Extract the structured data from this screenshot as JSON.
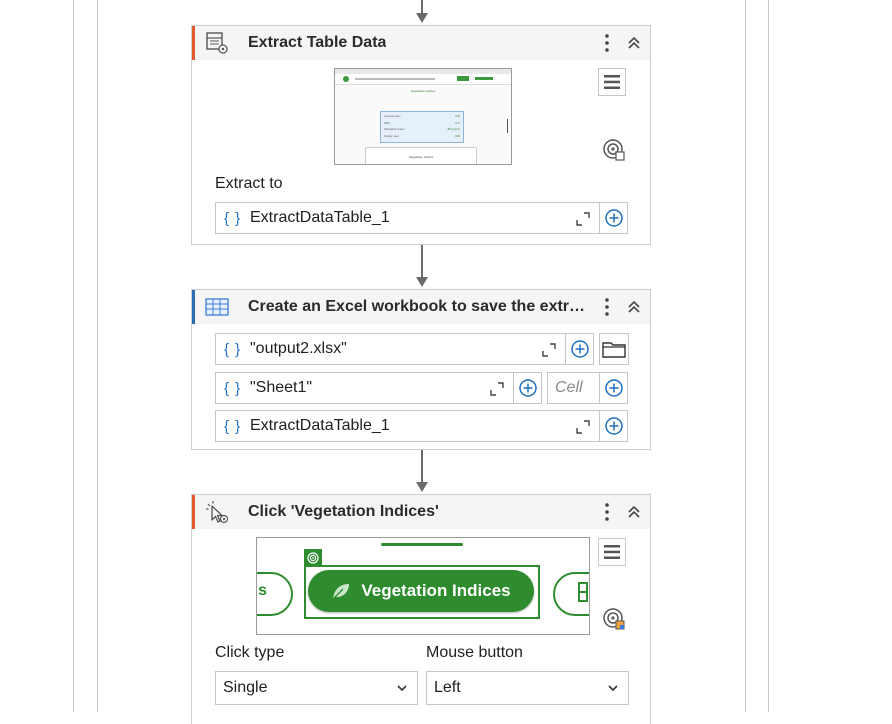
{
  "activities": [
    {
      "title": "Extract Table Data",
      "extract_label": "Extract to",
      "extract_value": "ExtractDataTable_1",
      "preview": {
        "heading": "Vegetation Indices",
        "rows": [
          "Leaf area index",
          "NDVI",
          "Chlorophyll content",
          "Canopy cover"
        ],
        "values": [
          "0.62",
          "0.74",
          "38.5 µg/cm²",
          "81%"
        ],
        "footer": "Vegetation Indices"
      }
    },
    {
      "title": "Create an Excel workbook to save the extra...",
      "file_value": "\"output2.xlsx\"",
      "sheet_value": "\"Sheet1\"",
      "cell_placeholder": "Cell",
      "data_value": "ExtractDataTable_1"
    },
    {
      "title": "Click 'Vegetation Indices'",
      "button_text": "Vegetation Indices",
      "left_stub": "s",
      "click_type_label": "Click type",
      "click_type_value": "Single",
      "mouse_button_label": "Mouse button",
      "mouse_button_value": "Left"
    }
  ],
  "colors": {
    "accent_orange": "#e05a2b",
    "accent_blue": "#2d6cb5",
    "link_blue": "#1f6fc1",
    "green_button": "#2e8b2e"
  },
  "icons": [
    "table-extract-icon",
    "excel-icon",
    "click-icon",
    "kebab-menu-icon",
    "collapse-icon",
    "target-icon",
    "hamburger-icon",
    "plus-circle-icon",
    "folder-icon",
    "expand-icon",
    "chevron-down-icon"
  ]
}
